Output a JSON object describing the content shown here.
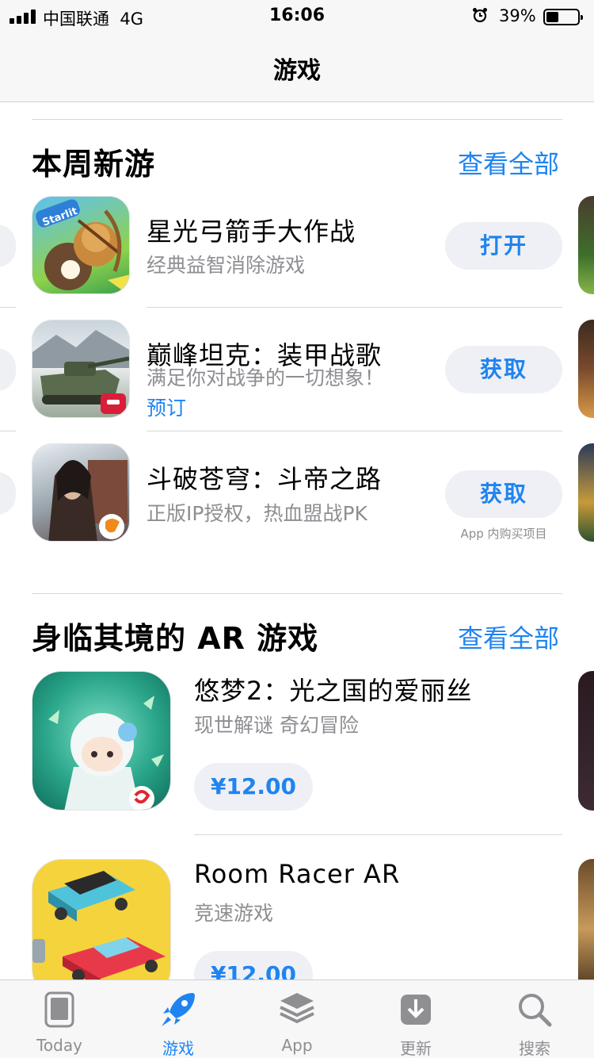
{
  "status_bar": {
    "carrier": "中国联通",
    "network": "4G",
    "time": "16:06",
    "battery": "39%",
    "battery_level": 0.39
  },
  "nav": {
    "title": "游戏"
  },
  "sections": [
    {
      "title": "本周新游",
      "see_all": "查看全部",
      "apps": [
        {
          "name": "星光弓箭手大作战",
          "subtitle": "经典益智消除游戏",
          "extra": "",
          "button": "打开",
          "note": ""
        },
        {
          "name": "巅峰坦克：装甲战歌",
          "subtitle": "满足你对战争的一切想象！",
          "extra": "预订",
          "button": "获取",
          "note": ""
        },
        {
          "name": "斗破苍穹：斗帝之路",
          "subtitle": "正版IP授权，热血盟战PK",
          "extra": "",
          "button": "获取",
          "note": "App 内购买项目"
        }
      ]
    },
    {
      "title": "身临其境的 AR 游戏",
      "see_all": "查看全部",
      "apps": [
        {
          "name": "悠梦2：光之国的爱丽丝",
          "subtitle": "现世解谜 奇幻冒险",
          "price": "¥12.00"
        },
        {
          "name": "Room Racer AR",
          "subtitle": "竞速游戏",
          "price": "¥12.00"
        }
      ]
    }
  ],
  "icons": {
    "app1_badge": "Starlit"
  },
  "tab_bar": [
    {
      "label": "Today",
      "icon": "today-icon",
      "active": false
    },
    {
      "label": "游戏",
      "icon": "rocket-icon",
      "active": true
    },
    {
      "label": "App",
      "icon": "layers-icon",
      "active": false
    },
    {
      "label": "更新",
      "icon": "download-icon",
      "active": false
    },
    {
      "label": "搜索",
      "icon": "search-icon",
      "active": false
    }
  ],
  "colors": {
    "accent": "#1f84f0",
    "secondary_text": "#8e8e93",
    "pill_bg": "#eff0f5"
  }
}
